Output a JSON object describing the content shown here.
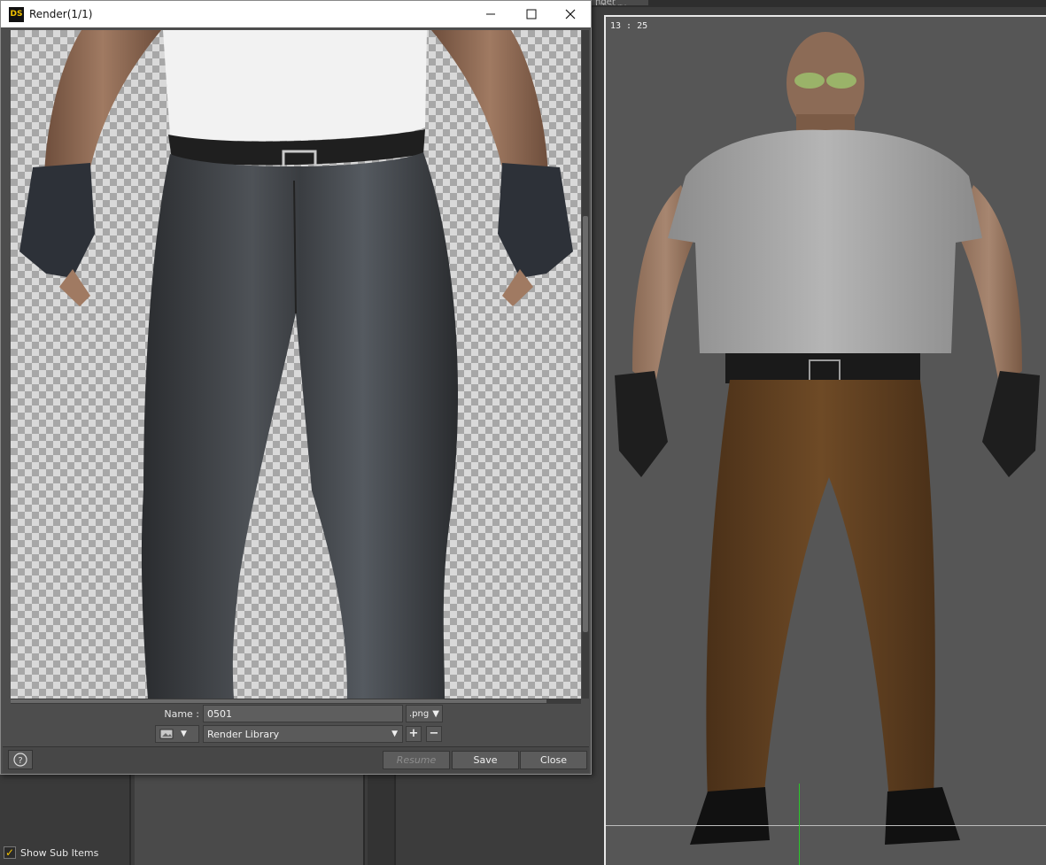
{
  "background": {
    "tab_label": "nder Library",
    "viewport_label": "13 : 25",
    "show_sub_items_label": "Show Sub Items",
    "show_sub_items_checked": true
  },
  "dialog": {
    "title": "Render(1/1)",
    "logo_text": "DS",
    "name_label": "Name :",
    "name_value": "0501",
    "format_value": ".png",
    "library_value": "Render Library",
    "plus_label": "+",
    "minus_label": "−",
    "buttons": {
      "resume": "Resume",
      "save": "Save",
      "close": "Close"
    }
  },
  "colors": {
    "viewport_bg": "#565656",
    "viewport_border": "#e8e8e8",
    "axis_green": "#29c829",
    "accent_yellow": "#f2c200"
  }
}
